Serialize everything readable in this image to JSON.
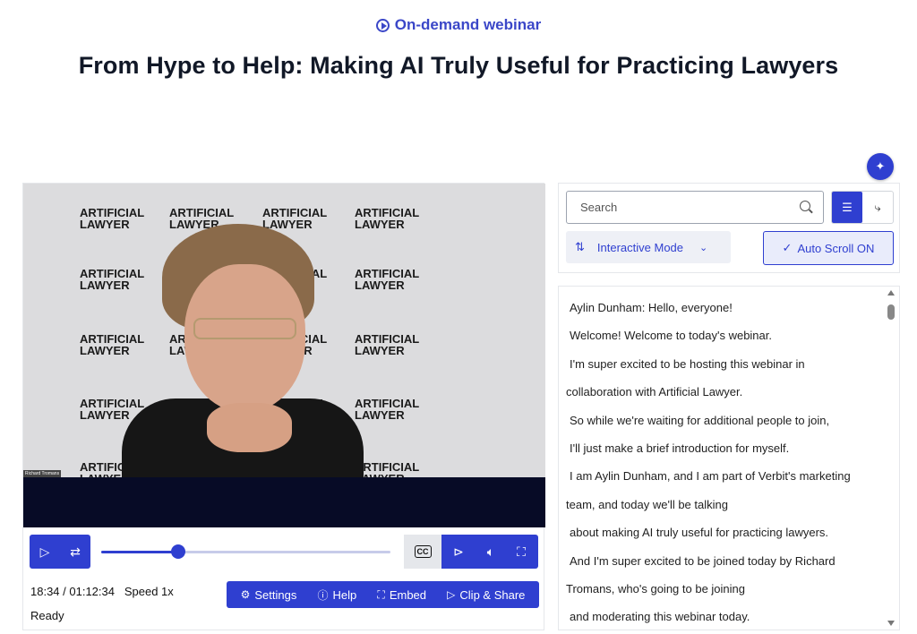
{
  "header": {
    "eyebrow": "On-demand webinar",
    "title": "From Hype to Help: Making AI Truly Useful for Practicing Lawyers"
  },
  "video": {
    "backdrop_logo": [
      "ARTIFICIAL",
      "LAWYER"
    ],
    "speaker_name_tag": "Richard Tromans",
    "progress_fraction": 0.265
  },
  "player": {
    "time": "18:34 / 01:12:34",
    "speed": "Speed 1x",
    "status": "Ready",
    "actions": {
      "settings": "Settings",
      "help": "Help",
      "embed": "Embed",
      "clip_share": "Clip & Share"
    }
  },
  "search": {
    "placeholder": "Search",
    "mode_label": "Interactive Mode",
    "autoscroll_label": "Auto Scroll ON"
  },
  "transcript": {
    "lines": [
      "Aylin Dunham: Hello, everyone!",
      "Welcome! Welcome to today's webinar.",
      "I'm super excited to be hosting this webinar in",
      "collaboration with Artificial Lawyer.",
      "So while we're waiting for additional people to join,",
      "I'll just make a brief introduction for myself.",
      "I am Aylin Dunham, and I am part of Verbit's marketing",
      "team, and today we'll be talking",
      "about making AI truly useful for practicing lawyers.",
      "And I'm super excited to be joined today by Richard",
      "Tromans, who's going to be joining",
      "and moderating this webinar today."
    ]
  },
  "colors": {
    "accent": "#2f3fd0",
    "title": "#111827",
    "letterbox": "#070b26"
  }
}
